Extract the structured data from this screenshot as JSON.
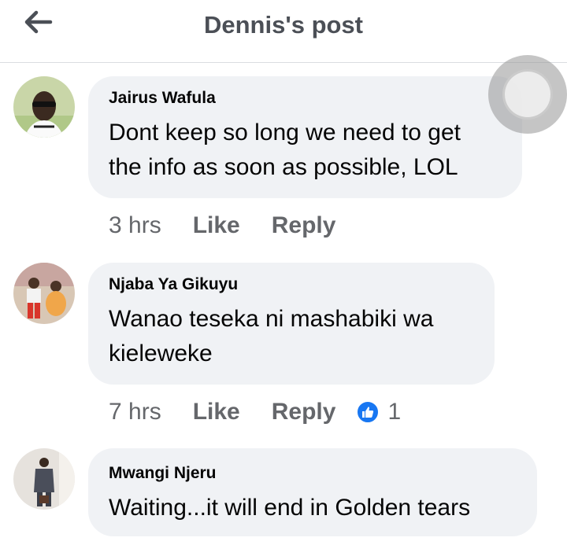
{
  "header": {
    "title": "Dennis's post"
  },
  "comments": [
    {
      "author": "Jairus Wafula",
      "text_lines": [
        "Dont keep so long we need to get",
        "the info as soon as possible, LOL"
      ],
      "time": "3 hrs",
      "like_label": "Like",
      "reply_label": "Reply"
    },
    {
      "author": "Njaba Ya Gikuyu",
      "text_lines": [
        "Wanao teseka ni mashabiki wa",
        "kieleweke"
      ],
      "time": "7 hrs",
      "like_label": "Like",
      "reply_label": "Reply",
      "reaction_count": "1"
    },
    {
      "author": "Mwangi Njeru",
      "text_lines": [
        "Waiting...it will end in Golden tears"
      ]
    }
  ],
  "icons": {
    "back": "arrow-left-icon",
    "reaction": "thumbs-up-icon"
  },
  "colors": {
    "bubble": "#f0f2f5",
    "meta": "#65676b",
    "like_blue": "#1877f2"
  }
}
